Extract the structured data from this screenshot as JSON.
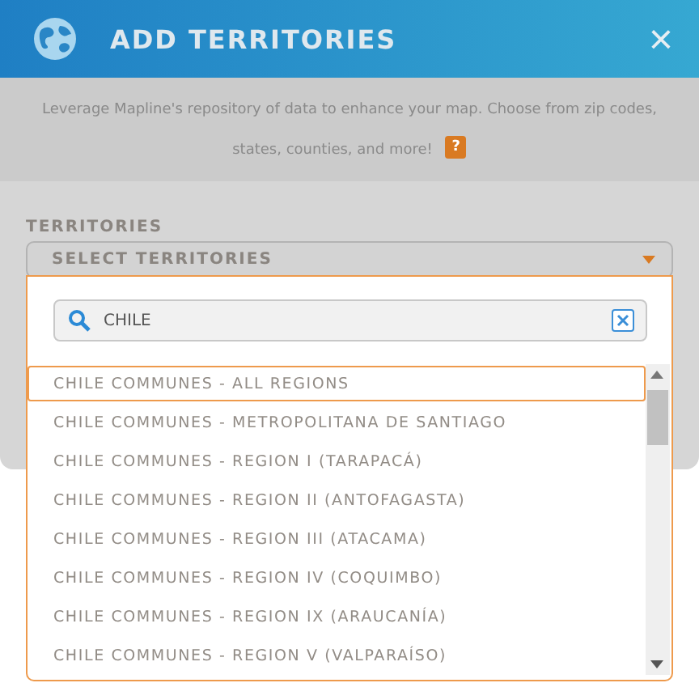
{
  "dialog": {
    "title": "ADD TERRITORIES",
    "close": "×",
    "description": [
      "Leverage Mapline's repository of data to enhance your map. Choose from zip codes,",
      "states, counties, and more!"
    ],
    "help": "?"
  },
  "territories": {
    "label": "TERRITORIES",
    "select": "SELECT TERRITORIES",
    "expanded": true,
    "search": {
      "value": "CHILE"
    },
    "options": [
      {
        "label": "CHILE COMMUNES - ALL REGIONS",
        "selected": true
      },
      {
        "label": "CHILE COMMUNES - METROPOLITANA DE SANTIAGO",
        "selected": false
      },
      {
        "label": "CHILE COMMUNES - REGION I (TARAPACÁ)",
        "selected": false
      },
      {
        "label": "CHILE COMMUNES - REGION II (ANTOFAGASTA)",
        "selected": false
      },
      {
        "label": "CHILE COMMUNES - REGION III (ATACAMA)",
        "selected": false
      },
      {
        "label": "CHILE COMMUNES - REGION IV (COQUIMBO)",
        "selected": false
      },
      {
        "label": "CHILE COMMUNES - REGION IX (ARAUCANÍA)",
        "selected": false
      },
      {
        "label": "CHILE COMMUNES - REGION V (VALPARAÍSO)",
        "selected": false
      }
    ]
  }
}
